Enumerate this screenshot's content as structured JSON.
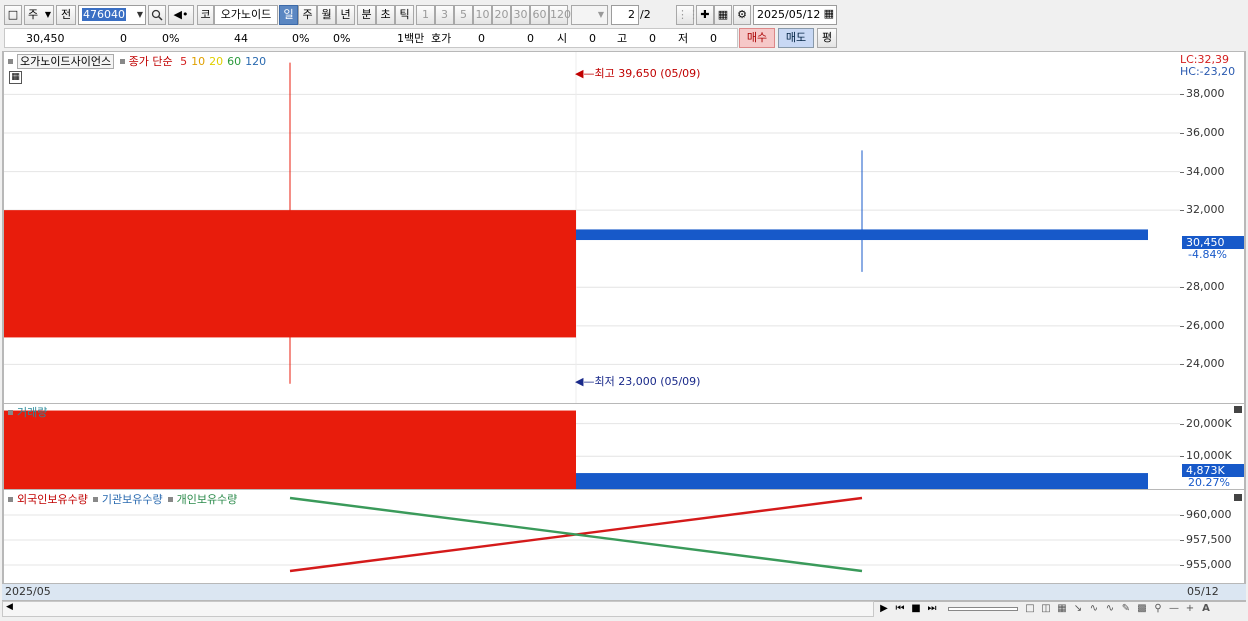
{
  "toolbar": {
    "type_select": "주",
    "prev_label": "전",
    "code": "476040",
    "market_label": "코",
    "stock_name": "오가노이드",
    "periods": [
      "일",
      "주",
      "월",
      "년",
      "분",
      "초",
      "틱"
    ],
    "active_period": "일",
    "intervals": [
      "1",
      "3",
      "5",
      "10",
      "20",
      "30",
      "60",
      "120"
    ],
    "page": "2",
    "page_total": "/2",
    "date": "2025/05/12"
  },
  "info": {
    "price": "30,450",
    "change": "0",
    "change_pct": "0%",
    "volume": "44",
    "vol_pct1": "0%",
    "vol_pct2": "0%",
    "unit": "1백만",
    "hoga_label": "호가",
    "hoga1": "0",
    "hoga2": "0",
    "open_label": "시",
    "open": "0",
    "high_label": "고",
    "high": "0",
    "low_label": "저",
    "low": "0",
    "buy_label": "매수",
    "sell_label": "매도",
    "eval_label": "평"
  },
  "price_pane": {
    "title": "오가노이드사이언스",
    "indicator": "종가 단순",
    "ma": [
      "5",
      "10",
      "20",
      "60",
      "120"
    ],
    "ma_colors": [
      "#d42020",
      "#e0a000",
      "#e0d000",
      "#2a9a3a",
      "#2a6ab0"
    ],
    "max_note": "최고 39,650 (05/09)",
    "min_note": "최저 23,000 (05/09)",
    "lc": "LC:32,39",
    "hc": "HC:-23,20",
    "ticks": [
      "38,000",
      "36,000",
      "34,000",
      "32,000",
      "28,000",
      "26,000",
      "24,000"
    ],
    "current_price": "30,450",
    "current_pct": "-4.84%"
  },
  "volume_pane": {
    "title": "거래량",
    "ticks": [
      "20,000K",
      "10,000K"
    ],
    "current": "4,873K",
    "current_pct": "20.27%"
  },
  "holding_pane": {
    "legend": [
      "외국인보유수량",
      "기관보유수량",
      "개인보유수량"
    ],
    "legend_colors": [
      "#c00000",
      "#2a6ab0",
      "#2a8a4a"
    ],
    "ticks": [
      "960,000",
      "957,500",
      "955,000"
    ]
  },
  "xaxis": {
    "start": "2025/05",
    "end": "05/12"
  },
  "chart_data": {
    "type": "candlestick",
    "candles": [
      {
        "date": "05/09",
        "open": 25400,
        "high": 39650,
        "low": 23000,
        "close": 32000,
        "volume": 24000000,
        "color": "#e81c0c"
      },
      {
        "date": "05/12",
        "open": 31000,
        "high": 35100,
        "low": 28800,
        "close": 30450,
        "volume": 4873000,
        "color": "#1759c9"
      }
    ],
    "price_range": [
      22000,
      40200
    ],
    "volume_range": [
      0,
      26000000
    ],
    "holding_series": [
      {
        "name": "외국인보유수량",
        "color": "#d41a1a",
        "values": [
          954400,
          961700
        ]
      },
      {
        "name": "개인보유수량",
        "color": "#3a9a5a",
        "values": [
          961700,
          954400
        ]
      }
    ],
    "holding_range": [
      953200,
      962500
    ]
  }
}
